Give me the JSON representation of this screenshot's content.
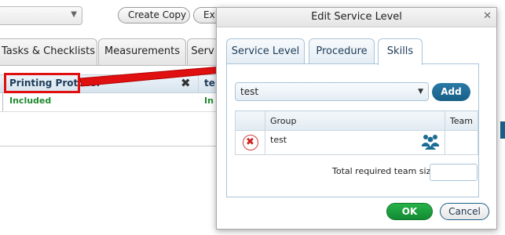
{
  "background": {
    "buttons": {
      "create_copy": "Create Copy",
      "export_partial": "Ex"
    },
    "tabs": {
      "tasks": "Tasks & Checklists",
      "measurements": "Measurements",
      "service_partial": "Serv"
    },
    "table": {
      "col1_header": "Printing Protocol",
      "col2_header_partial": "te",
      "col1_value": "Included",
      "col2_value_partial": "In"
    },
    "highlight_color": "#e01010"
  },
  "dialog": {
    "title": "Edit Service Level",
    "tabs": [
      "Service Level",
      "Procedure",
      "Skills"
    ],
    "active_tab": "Skills",
    "skill_select": {
      "value": "test"
    },
    "add_label": "Add",
    "grid": {
      "headers": {
        "group": "Group",
        "team": "Team"
      },
      "rows": [
        {
          "group": "test",
          "team": ""
        }
      ]
    },
    "team_size": {
      "label": "Total required team size:",
      "value": ""
    },
    "ok_label": "OK",
    "cancel_label": "Cancel",
    "colors": {
      "ok": "#1ea13f",
      "primary": "#1b5f8a",
      "delete": "#d02020"
    }
  }
}
